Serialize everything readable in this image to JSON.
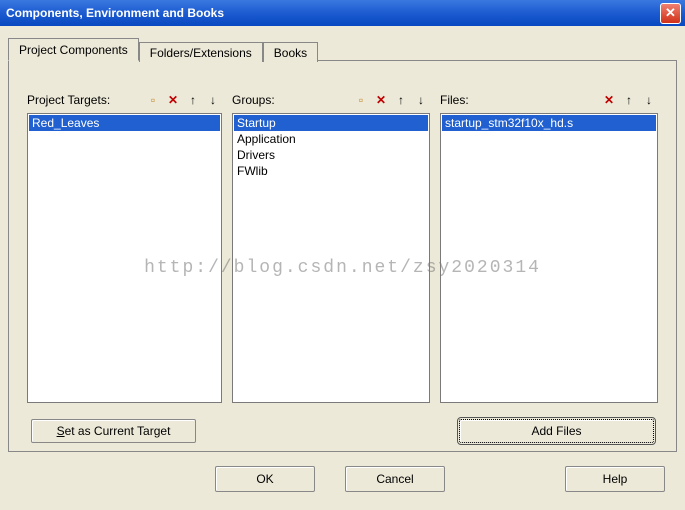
{
  "window": {
    "title": "Components, Environment and Books"
  },
  "tabs": {
    "project_components": "Project Components",
    "folders_extensions": "Folders/Extensions",
    "books": "Books"
  },
  "columns": {
    "targets": {
      "label": "Project Targets:",
      "items": [
        "Red_Leaves"
      ],
      "selected": 0
    },
    "groups": {
      "label": "Groups:",
      "items": [
        "Startup",
        "Application",
        "Drivers",
        "FWlib"
      ],
      "selected": 0
    },
    "files": {
      "label": "Files:",
      "items": [
        "startup_stm32f10x_hd.s"
      ],
      "selected": 0
    }
  },
  "buttons": {
    "set_as_current_target": "Set as Current Target",
    "add_files": "Add Files",
    "ok": "OK",
    "cancel": "Cancel",
    "help": "Help"
  },
  "watermark": "http://blog.csdn.net/zsy2020314"
}
